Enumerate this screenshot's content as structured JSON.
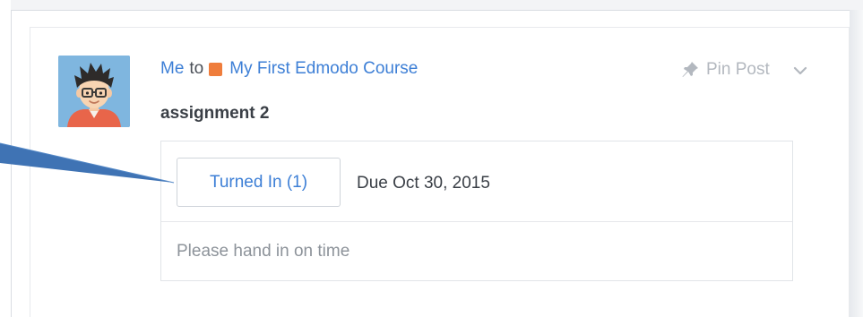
{
  "post": {
    "sender": "Me",
    "to_word": "to",
    "group_name": "My First Edmodo Course",
    "pin_label": "Pin Post",
    "title": "assignment 2",
    "turned_in_label": "Turned In (1)",
    "due_label": "Due Oct 30, 2015",
    "description": "Please hand in on time"
  },
  "icons": {
    "pin": "pin-icon",
    "chevron": "chevron-down-icon",
    "group": "group-color-square",
    "callout": "callout-arrow"
  },
  "colors": {
    "link": "#3d7fd6",
    "group_square": "#ef7d3c",
    "callout_arrow": "#3f73b4",
    "muted": "#b3b8bf",
    "avatar_bg": "#7fb6df"
  }
}
